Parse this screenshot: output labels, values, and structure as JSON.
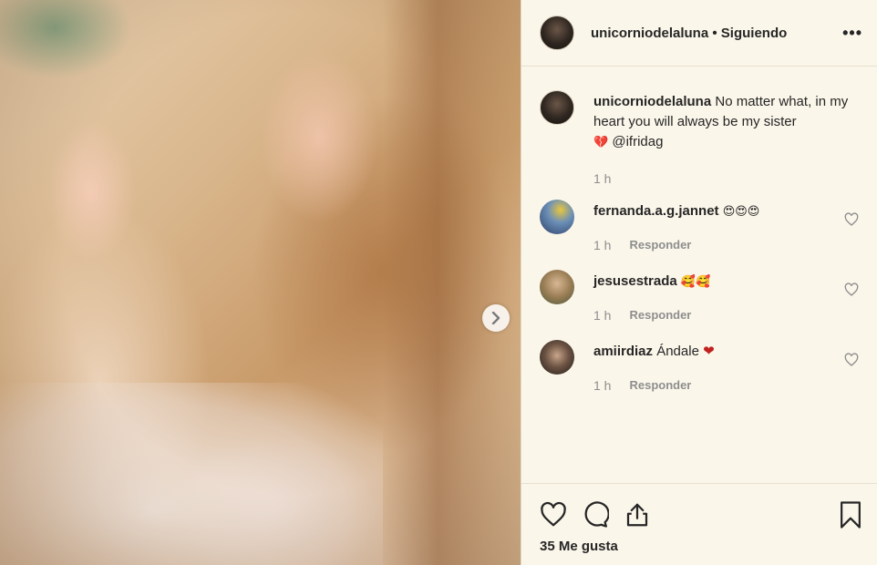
{
  "post": {
    "username": "unicorniodelaluna",
    "follow_status": "• Siguiendo",
    "more_icon": "more-options-icon",
    "likes_text": "35 Me gusta"
  },
  "caption": {
    "username": "unicorniodelaluna",
    "text": "No matter what, in my heart you will always be my sister",
    "emoji": "💔",
    "mention": "@ifridag",
    "time": "1 h"
  },
  "comments": [
    {
      "username": "fernanda.a.g.jannet",
      "text": "😍😍😍",
      "time": "1 h",
      "reply_label": "Responder"
    },
    {
      "username": "jesusestrada",
      "text": "🥰🥰",
      "time": "1 h",
      "reply_label": "Responder"
    },
    {
      "username": "amiirdiaz",
      "text": "Ándale",
      "emoji": "❤",
      "time": "1 h",
      "reply_label": "Responder"
    }
  ],
  "colors": {
    "background": "#fbf6ea",
    "text": "#262626",
    "muted": "#8e8e8e",
    "heart_red": "#c0201e"
  }
}
